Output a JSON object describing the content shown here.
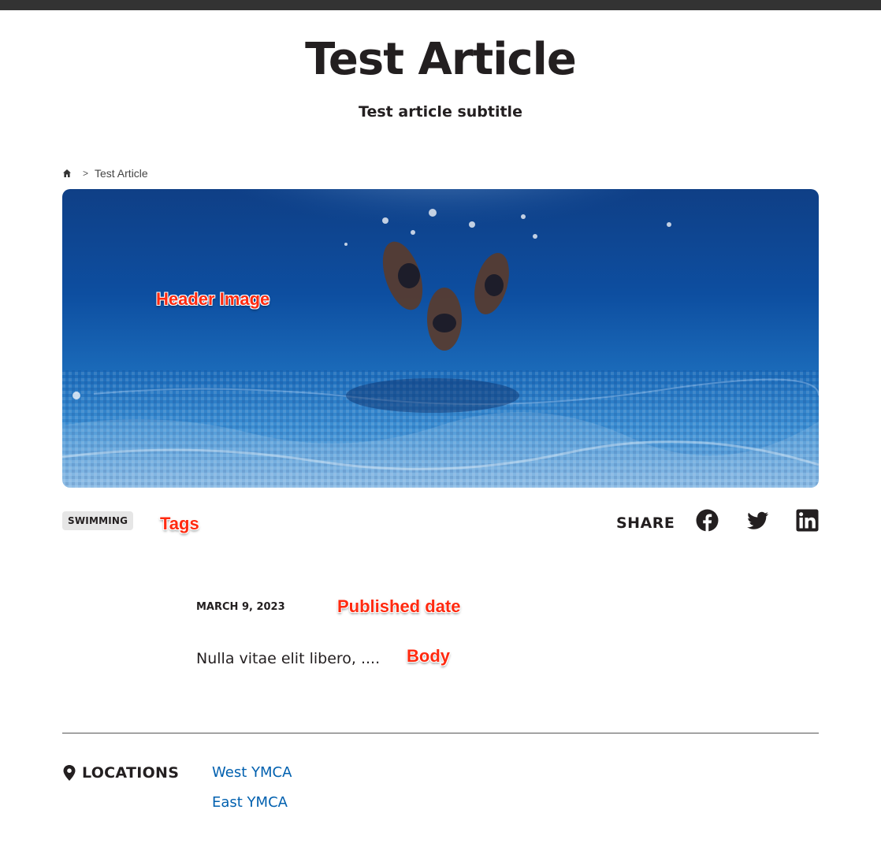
{
  "page": {
    "title": "Test Article",
    "subtitle": "Test article subtitle"
  },
  "breadcrumb": {
    "home_icon": "home-icon",
    "separator": ">",
    "current": "Test Article"
  },
  "hero": {
    "annotation": "Header Image"
  },
  "tags": {
    "items": [
      "SWIMMING"
    ],
    "annotation": "Tags"
  },
  "share": {
    "label": "SHARE",
    "icons": [
      "facebook-icon",
      "twitter-icon",
      "linkedin-icon"
    ]
  },
  "article": {
    "published_date": "MARCH 9, 2023",
    "date_annotation": "Published date",
    "body": "Nulla vitae elit libero, ....",
    "body_annotation": "Body"
  },
  "locations": {
    "heading": "LOCATIONS",
    "icon": "map-pin-icon",
    "items": [
      "West YMCA",
      "East YMCA"
    ]
  },
  "colors": {
    "text": "#231f20",
    "link": "#0060af",
    "annotation": "#ff2a10",
    "topbar": "#333333",
    "tag_bg": "#e6e6e6"
  }
}
